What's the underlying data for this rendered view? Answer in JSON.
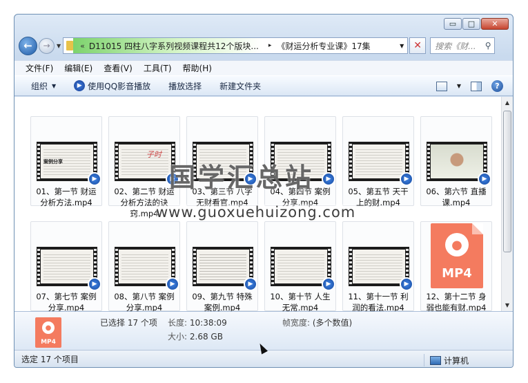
{
  "window": {
    "caption_buttons": {
      "minimize": "▭",
      "maximize": "□",
      "close": "✕"
    },
    "breadcrumb": {
      "chevron": "«",
      "segments": [
        "D11015 四柱八字系列视频课程共12个版块...",
        "《财运分析专业课》17集"
      ],
      "separator": "▸",
      "dropdown": "▼"
    },
    "search": {
      "placeholder": "搜索《财...",
      "icon": "search-icon"
    }
  },
  "menu": [
    "文件(F)",
    "编辑(E)",
    "查看(V)",
    "工具(T)",
    "帮助(H)"
  ],
  "toolbar": {
    "organize": "组织",
    "play_qq": "使用QQ影音播放",
    "play_selection": "播放选择",
    "new_folder": "新建文件夹",
    "help": "?"
  },
  "files": [
    {
      "label": "01、第一节 财运分析方法.mp4",
      "thumb": "doc"
    },
    {
      "label": "02、第二节 财运分析方法的诀窍.mp4",
      "thumb": "doc"
    },
    {
      "label": "03、第三节 八字无财看官.mp4",
      "thumb": "doc"
    },
    {
      "label": "04、第四节 案例分享.mp4",
      "thumb": "doc"
    },
    {
      "label": "05、第五节 天干上的财.mp4",
      "thumb": "doc"
    },
    {
      "label": "06、第六节 直播课.mp4",
      "thumb": "photo"
    },
    {
      "label": "07、第七节 案例分享.mp4",
      "thumb": "doc"
    },
    {
      "label": "08、第八节 案例分享.mp4",
      "thumb": "doc"
    },
    {
      "label": "09、第九节 特殊案例.mp4",
      "thumb": "doc"
    },
    {
      "label": "10、第十节 人生无常.mp4",
      "thumb": "doc"
    },
    {
      "label": "11、第十一节 利润的看法.mp4",
      "thumb": "doc"
    },
    {
      "label": "12、第十二节 身弱也能有财.mp4",
      "thumb": "mp4"
    }
  ],
  "thumb_texts": {
    "t1": "案例分享",
    "t2": "子时",
    "mp4": "MP4"
  },
  "watermark": {
    "cn": "国学汇总站",
    "url": "www.guoxuehuizong.com"
  },
  "details": {
    "icon_label": "MP4",
    "selected": "已选择 17 个项",
    "length_key": "长度:",
    "length_val": "10:38:09",
    "size_key": "大小:",
    "size_val": "2.68 GB",
    "fw_key": "帧宽度:",
    "fw_val": "(多个数值)"
  },
  "status": {
    "left": "选定 17 个项目",
    "right": "计算机"
  }
}
